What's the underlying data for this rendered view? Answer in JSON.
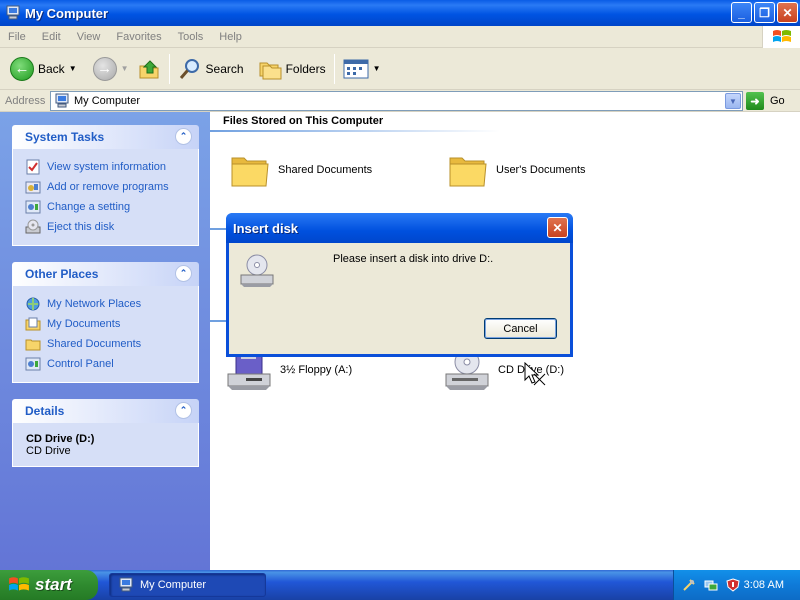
{
  "window": {
    "title": "My Computer",
    "buttons": [
      "minimize",
      "maximize",
      "close"
    ]
  },
  "menu": [
    "File",
    "Edit",
    "View",
    "Favorites",
    "Tools",
    "Help"
  ],
  "toolbar": {
    "back_label": "Back",
    "search_label": "Search",
    "folders_label": "Folders"
  },
  "address": {
    "label": "Address",
    "value": "My Computer",
    "go_label": "Go"
  },
  "left_panel": {
    "system_tasks": {
      "title": "System Tasks",
      "items": [
        {
          "label": "View system information",
          "icon": "system-info-icon"
        },
        {
          "label": "Add or remove programs",
          "icon": "add-remove-icon"
        },
        {
          "label": "Change a setting",
          "icon": "control-panel-icon"
        },
        {
          "label": "Eject this disk",
          "icon": "eject-icon"
        }
      ]
    },
    "other_places": {
      "title": "Other Places",
      "items": [
        {
          "label": "My Network Places",
          "icon": "network-icon"
        },
        {
          "label": "My Documents",
          "icon": "documents-icon"
        },
        {
          "label": "Shared Documents",
          "icon": "folder-icon"
        },
        {
          "label": "Control Panel",
          "icon": "control-panel-icon"
        }
      ]
    },
    "details": {
      "title": "Details",
      "name": "CD Drive (D:)",
      "type": "CD Drive"
    }
  },
  "main": {
    "group_title": "Files Stored on This Computer",
    "items": [
      {
        "label": "Shared Documents",
        "icon": "folder-icon"
      },
      {
        "label": "User's Documents",
        "icon": "folder-icon"
      },
      {
        "label": "3½ Floppy (A:)",
        "icon": "floppy-icon"
      },
      {
        "label": "CD Drive (D:)",
        "icon": "cd-drive-icon"
      }
    ]
  },
  "dialog": {
    "title": "Insert disk",
    "message": "Please insert a disk into drive D:.",
    "cancel_label": "Cancel"
  },
  "taskbar": {
    "start_label": "start",
    "window_button": "My Computer",
    "clock": "3:08 AM"
  },
  "colors": {
    "titlebar": "#0054e3",
    "panel": "#6f8ddd",
    "link": "#215dc6",
    "dialog_bg": "#ece9d8",
    "start": "#2f8a2f"
  }
}
